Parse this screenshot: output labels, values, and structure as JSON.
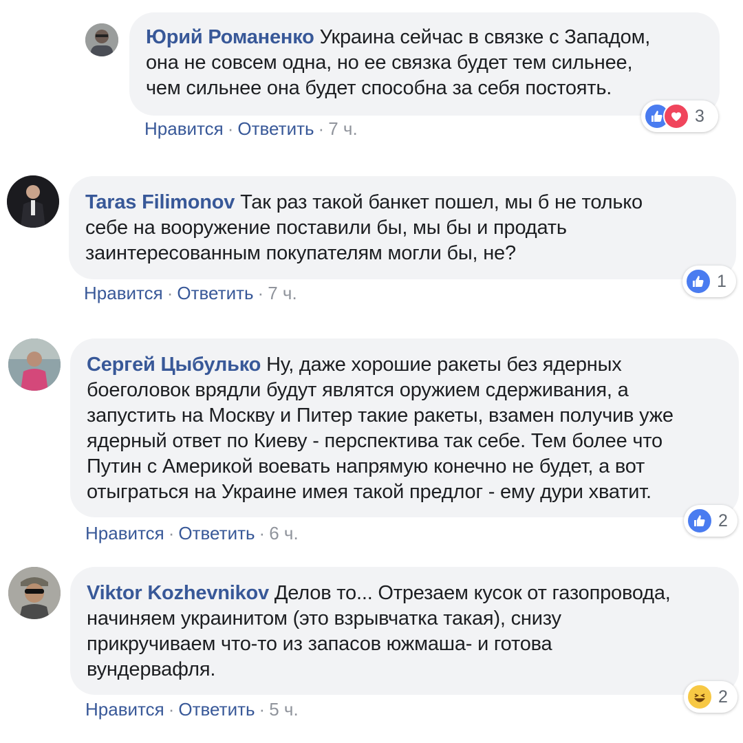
{
  "comments": [
    {
      "author": "Юрий Романенко",
      "lines": [
        "Украина сейчас в связке с Западом,",
        "она не совсем одна, но ее связка будет тем сильнее,",
        "чем сильнее она будет способна за себя постоять."
      ],
      "actions": {
        "like": "Нравится",
        "reply": "Ответить",
        "time": "7 ч."
      },
      "reactions": {
        "types": [
          "like-icon",
          "love-icon"
        ],
        "count": "3"
      }
    },
    {
      "author": "Taras Filimonov",
      "lines": [
        "Так раз такой банкет пошел, мы б не только",
        "себе на вооружение поставили бы, мы бы и продать",
        "заинтересованным покупателям могли бы, не?"
      ],
      "actions": {
        "like": "Нравится",
        "reply": "Ответить",
        "time": "7 ч."
      },
      "reactions": {
        "types": [
          "like-icon"
        ],
        "count": "1"
      }
    },
    {
      "author": "Сергей Цыбулько",
      "lines": [
        "Ну, даже хорошие ракеты без ядерных",
        "боеголовок врядли будут являтся оружием сдерживания, а",
        "запустить на Москву и Питер такие ракеты, взамен получив уже",
        "ядерный ответ по Киеву - перспектива так себе. Тем более что",
        "Путин с Америкой воевать напрямую конечно не будет, а вот",
        "отыграться на Украине имея такой предлог - ему дури хватит."
      ],
      "actions": {
        "like": "Нравится",
        "reply": "Ответить",
        "time": "6 ч."
      },
      "reactions": {
        "types": [
          "like-icon"
        ],
        "count": "2"
      }
    },
    {
      "author": "Viktor Kozhevnikov",
      "lines": [
        "Делов то... Отрезаем кусок от газопровода,",
        "начиняем украинитом (это взрывчатка такая), снизу",
        "прикручиваем что-то из запасов южмаша- и готова",
        "вундервафля."
      ],
      "actions": {
        "like": "Нравится",
        "reply": "Ответить",
        "time": "5 ч."
      },
      "reactions": {
        "types": [
          "haha-icon"
        ],
        "count": "2"
      }
    }
  ]
}
